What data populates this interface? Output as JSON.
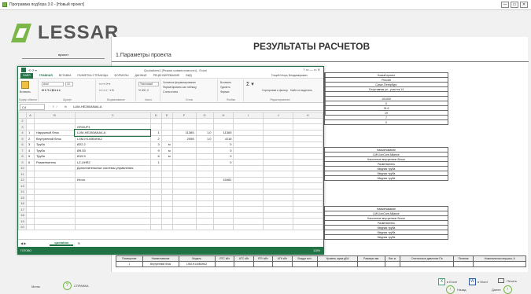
{
  "window": {
    "title": "Программа подбора 3.0 - [Новый проект]",
    "buttons": [
      "—",
      "▭",
      "✕"
    ]
  },
  "logo": {
    "text": "LESSAR"
  },
  "nav": {
    "items": [
      "проект",
      "",
      "",
      "",
      "",
      ""
    ]
  },
  "content": {
    "title": "РЕЗУЛЬТАТЫ РАСЧЕТОВ",
    "params_title": "1.Параметры проекта",
    "project_rows": [
      "Новый проект",
      "Россия",
      "Санкт-Петербург",
      "Спортивная ул., участок 14",
      "",
      "101000",
      "0",
      "24,6",
      "19",
      "7",
      "0"
    ],
    "sub1_rows": [
      "Наименование",
      "LMV-IceCore Alliance",
      "Кассетные внутренние блоки",
      "Разветвитель",
      "Медная труба",
      "Медная труба",
      "Медная труба"
    ],
    "sub2_rows": [
      "Наименование",
      "LMV-IceCore Alliance",
      "Кассетные внутренние блоки",
      "Разветвитель",
      "Медная труба",
      "Медная труба",
      "Медная труба"
    ],
    "bottom_headers": [
      "Помещение",
      "Наименование",
      "Модель",
      "RTC кВт",
      "ATC кВт",
      "RTH кВт",
      "ATH кВт",
      "Воздух м³/ч",
      "Уровень шума дБА",
      "Размеры мм",
      "Вес кг",
      "Статическое давление Па",
      "Питание",
      "Номинальная нагрузка, А"
    ],
    "bottom_row": [
      "1",
      "Внутренний блок",
      "LSM-H140B4HA2",
      "",
      "",
      "",
      "",
      "",
      "",
      "",
      "",
      "",
      "",
      ""
    ]
  },
  "footer": {
    "menu": "Меню",
    "help": "СПРАВКА",
    "to_excel": "в Excel",
    "to_word": "в Word",
    "print": "Печать",
    "back": "Назад",
    "next": "Далее"
  },
  "excel": {
    "title": "Quotations1 [Режим совместимости] - Excel",
    "menu": [
      "ФАЙЛ",
      "ГЛАВНАЯ",
      "ВСТАВКА",
      "РАЗМЕТКА СТРАНИЦЫ",
      "ФОРМУЛЫ",
      "ДАННЫЕ",
      "РЕЦЕНЗИРОВАНИЕ",
      "ВИД"
    ],
    "user": "Тощий Игорь Владимирович",
    "ribbon": {
      "clipboard": "Буфер обмена",
      "paste": "Вставить",
      "font": "Шрифт",
      "font_name": "Arial",
      "font_size": "10",
      "alignment": "Выравнивание",
      "number": "Число",
      "number_fmt": "Текстовый",
      "styles": "Стили",
      "cond_fmt": "Условное форматирование",
      "fmt_table": "Форматировать как таблицу",
      "cell_styles": "Стили ячеек",
      "cells": "Ячейки",
      "insert": "Вставить",
      "delete": "Удалить",
      "format": "Формат",
      "editing": "Редактирование",
      "sort": "Сортировка и фильтр",
      "find": "Найти и выделить"
    },
    "namebox": "C4",
    "formula": "LUM-HE280ANA4-A",
    "col_headers": [
      "",
      "A",
      "B",
      "C",
      "D",
      "E",
      "F",
      "G",
      "H",
      "I",
      "J",
      "K"
    ],
    "rows": [
      [
        "2",
        "",
        "",
        "",
        "",
        "",
        "",
        "",
        "",
        "",
        "",
        ""
      ],
      [
        "3",
        "",
        "",
        "GROUP1",
        "",
        "",
        "",
        "",
        "",
        "",
        "",
        ""
      ],
      [
        "4",
        "1",
        "Наружный блок",
        "LUM-HE280ANA4-A",
        "1",
        "",
        "11365",
        "1,0",
        "11365",
        "",
        "",
        ""
      ],
      [
        "5",
        "2",
        "Внутренний блок",
        "LSM-H140B4HA2",
        "2",
        "",
        "2058",
        "1,0",
        "4116",
        "",
        "",
        ""
      ],
      [
        "6",
        "3",
        "Труба",
        "Ø22.2",
        "3",
        "м",
        "",
        "",
        "0",
        "",
        "",
        ""
      ],
      [
        "7",
        "4",
        "Труба",
        "Ø9.53",
        "9",
        "м",
        "",
        "",
        "0",
        "",
        "",
        ""
      ],
      [
        "8",
        "5",
        "Труба",
        "Ø15.9",
        "6",
        "м",
        "",
        "",
        "0",
        "",
        "",
        ""
      ],
      [
        "9",
        "6",
        "Разветвитель",
        "LZ-UHR2",
        "1",
        "",
        "",
        "",
        "0",
        "",
        "",
        ""
      ],
      [
        "10",
        "",
        "",
        "Дополнительные системы управления",
        "",
        "",
        "",
        "",
        "",
        "",
        "",
        ""
      ],
      [
        "11",
        "",
        "",
        "",
        "",
        "",
        "",
        "",
        "",
        "",
        "",
        ""
      ],
      [
        "12",
        "",
        "",
        "Итого",
        "",
        "",
        "",
        "",
        "15481",
        "",
        "",
        ""
      ],
      [
        "13",
        "",
        "",
        "",
        "",
        "",
        "",
        "",
        "",
        "",
        "",
        ""
      ],
      [
        "14",
        "",
        "",
        "",
        "",
        "",
        "",
        "",
        "",
        "",
        "",
        ""
      ],
      [
        "15",
        "",
        "",
        "",
        "",
        "",
        "",
        "",
        "",
        "",
        "",
        ""
      ],
      [
        "16",
        "",
        "",
        "",
        "",
        "",
        "",
        "",
        "",
        "",
        "",
        ""
      ],
      [
        "17",
        "",
        "",
        "",
        "",
        "",
        "",
        "",
        "",
        "",
        "",
        ""
      ],
      [
        "18",
        "",
        "",
        "",
        "",
        "",
        "",
        "",
        "",
        "",
        "",
        ""
      ],
      [
        "19",
        "",
        "",
        "",
        "",
        "",
        "",
        "",
        "",
        "",
        "",
        ""
      ],
      [
        "20",
        "",
        "",
        "",
        "",
        "",
        "",
        "",
        "",
        "",
        "",
        ""
      ]
    ],
    "sheet_tab": "quotation",
    "status": "ГОТОВО",
    "zoom": "110%"
  }
}
